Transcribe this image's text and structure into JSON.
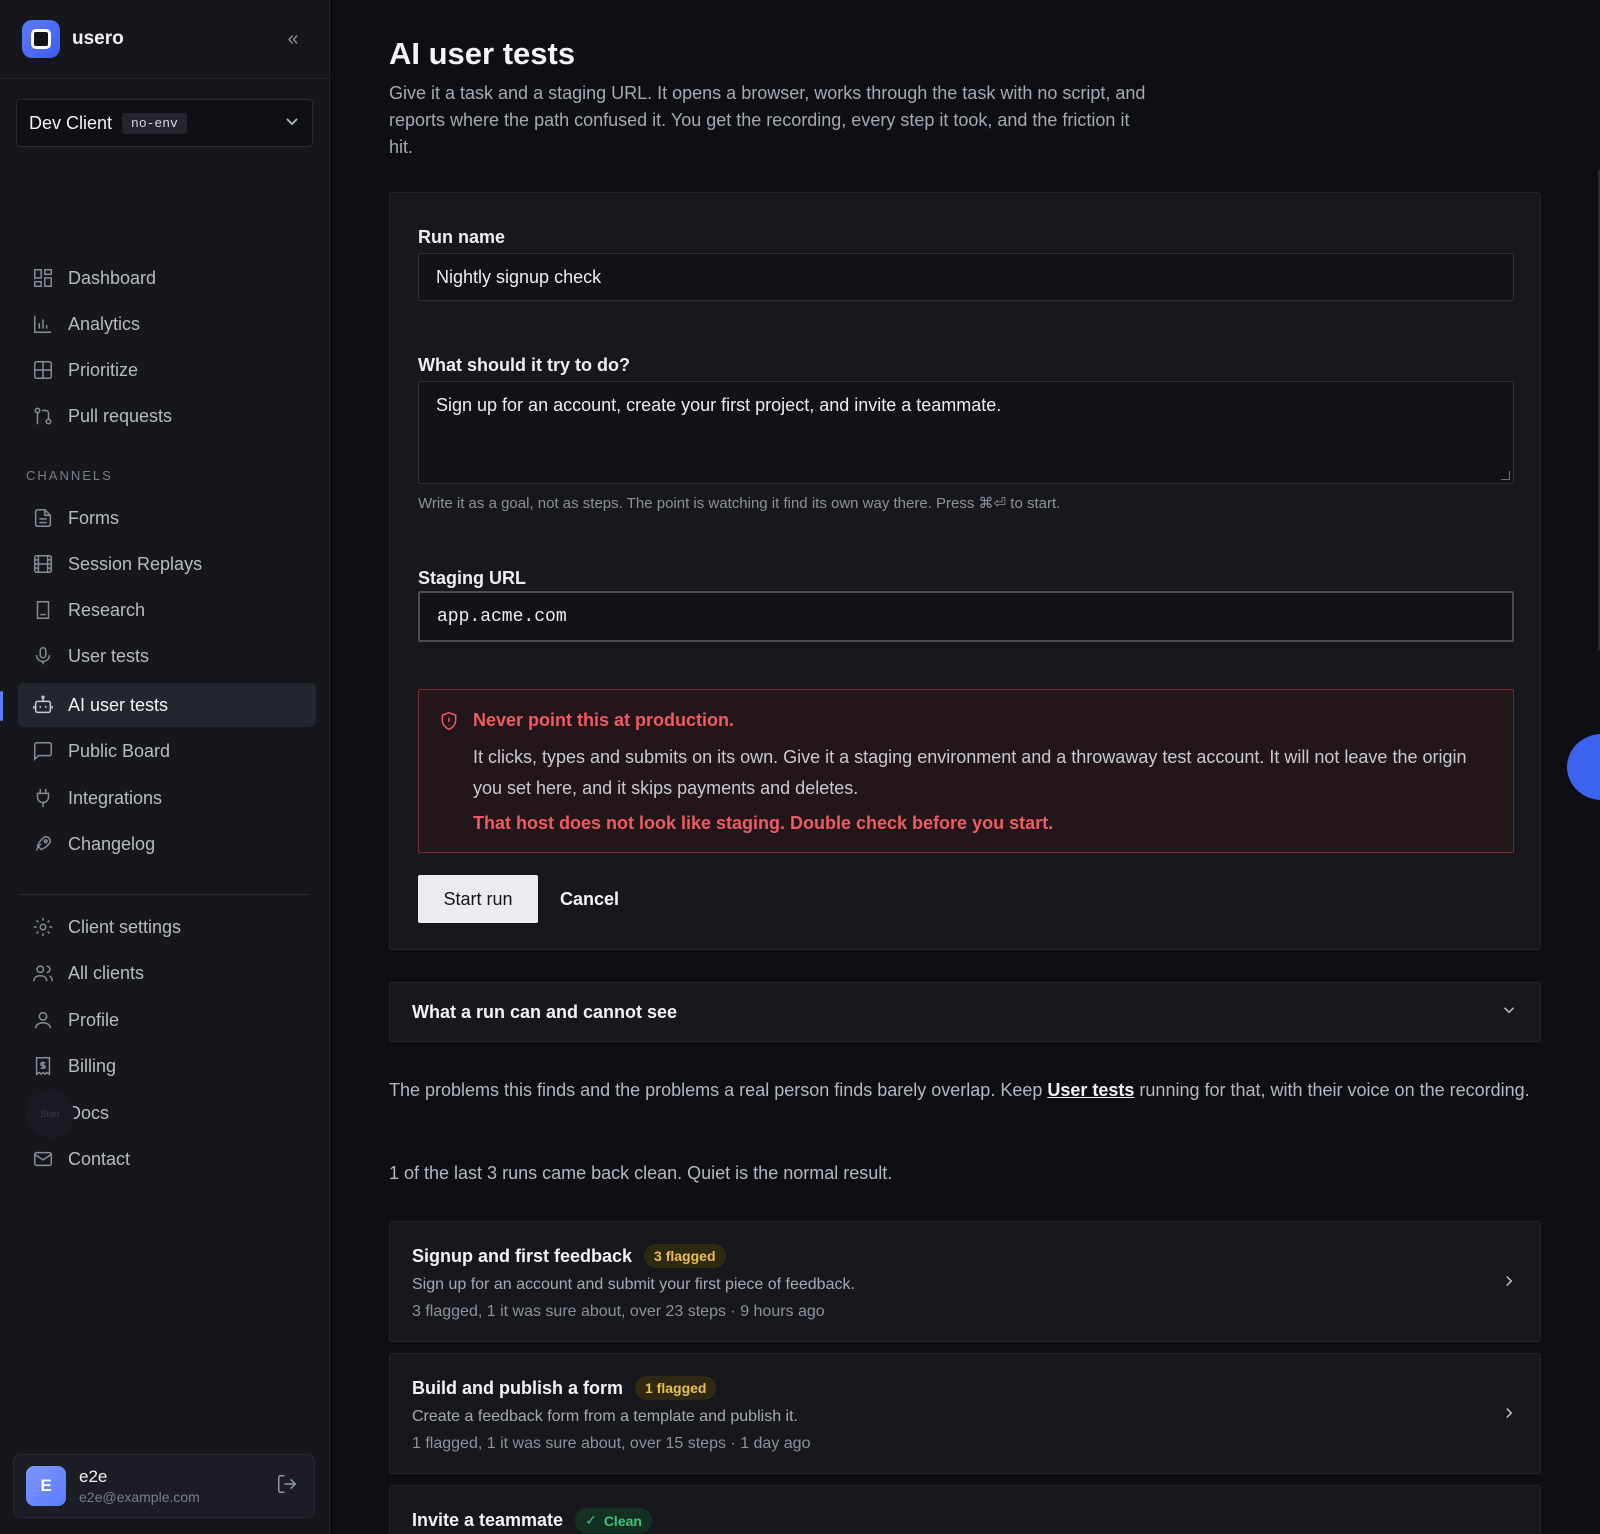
{
  "brand": {
    "name": "usero"
  },
  "client": {
    "name": "Dev Client",
    "env": "no-env"
  },
  "nav": {
    "main": [
      {
        "label": "Dashboard",
        "icon": "dashboard-icon"
      },
      {
        "label": "Analytics",
        "icon": "analytics-icon"
      },
      {
        "label": "Prioritize",
        "icon": "prioritize-icon"
      },
      {
        "label": "Pull requests",
        "icon": "pull-request-icon"
      }
    ],
    "channels_label": "CHANNELS",
    "channels": [
      {
        "label": "Forms",
        "icon": "form-icon"
      },
      {
        "label": "Session Replays",
        "icon": "film-icon"
      },
      {
        "label": "Research",
        "icon": "research-icon"
      },
      {
        "label": "User tests",
        "icon": "microphone-icon"
      },
      {
        "label": "AI user tests",
        "icon": "robot-icon",
        "active": true
      },
      {
        "label": "Public Board",
        "icon": "message-square-icon"
      },
      {
        "label": "Integrations",
        "icon": "plug-icon"
      },
      {
        "label": "Changelog",
        "icon": "rocket-icon"
      }
    ],
    "settings": [
      {
        "label": "Client settings",
        "icon": "gear-icon"
      },
      {
        "label": "All clients",
        "icon": "users-icon"
      },
      {
        "label": "Profile",
        "icon": "user-icon"
      },
      {
        "label": "Billing",
        "icon": "receipt-icon"
      },
      {
        "label": "Docs",
        "icon": "book-icon"
      },
      {
        "label": "Contact",
        "icon": "mail-icon"
      }
    ],
    "start_ghost": "Start"
  },
  "user": {
    "initial": "E",
    "name": "e2e",
    "email": "e2e@example.com"
  },
  "page": {
    "title": "AI user tests",
    "description": "Give it a task and a staging URL. It opens a browser, works through the task with no script, and reports where the path confused it. You get the recording, every step it took, and the friction it hit."
  },
  "form": {
    "run_name_label": "Run name",
    "run_name_value": "Nightly signup check",
    "task_label": "What should it try to do?",
    "task_value": "Sign up for an account, create your first project, and invite a teammate.",
    "task_hint": "Write it as a goal, not as steps. The point is watching it find its own way there. Press ⌘⏎ to start.",
    "url_label": "Staging URL",
    "url_value": "app.acme.com",
    "warning_title": "Never point this at production.",
    "warning_body": "It clicks, types and submits on its own. Give it a staging environment and a throwaway test account. It will not leave the origin you set here, and it skips payments and deletes.",
    "warning_alert": "That host does not look like staging. Double check before you start.",
    "start_label": "Start run",
    "cancel_label": "Cancel"
  },
  "accordion": {
    "title": "What a run can and cannot see"
  },
  "note": {
    "before": "The problems this finds and the problems a real person finds barely overlap. Keep ",
    "link": "User tests",
    "after": " running for that, with their voice on the recording."
  },
  "summary": "1 of the last 3 runs came back clean. Quiet is the normal result.",
  "runs": [
    {
      "title": "Signup and first feedback",
      "badge": "3 flagged",
      "status": "flagged",
      "desc": "Sign up for an account and submit your first piece of feedback.",
      "meta": "3 flagged, 1 it was sure about, over 23 steps · 9 hours ago"
    },
    {
      "title": "Build and publish a form",
      "badge": "1 flagged",
      "status": "flagged",
      "desc": "Create a feedback form from a template and publish it.",
      "meta": "1 flagged, 1 it was sure about, over 15 steps · 1 day ago"
    },
    {
      "title": "Invite a teammate",
      "badge": "Clean",
      "status": "clean",
      "desc": "",
      "meta": ""
    }
  ],
  "colors": {
    "accent": "#5b7cff",
    "danger": "#ef5a63",
    "flag": "#e9c04a",
    "clean": "#3fc27a",
    "background": "#0e0f14"
  }
}
